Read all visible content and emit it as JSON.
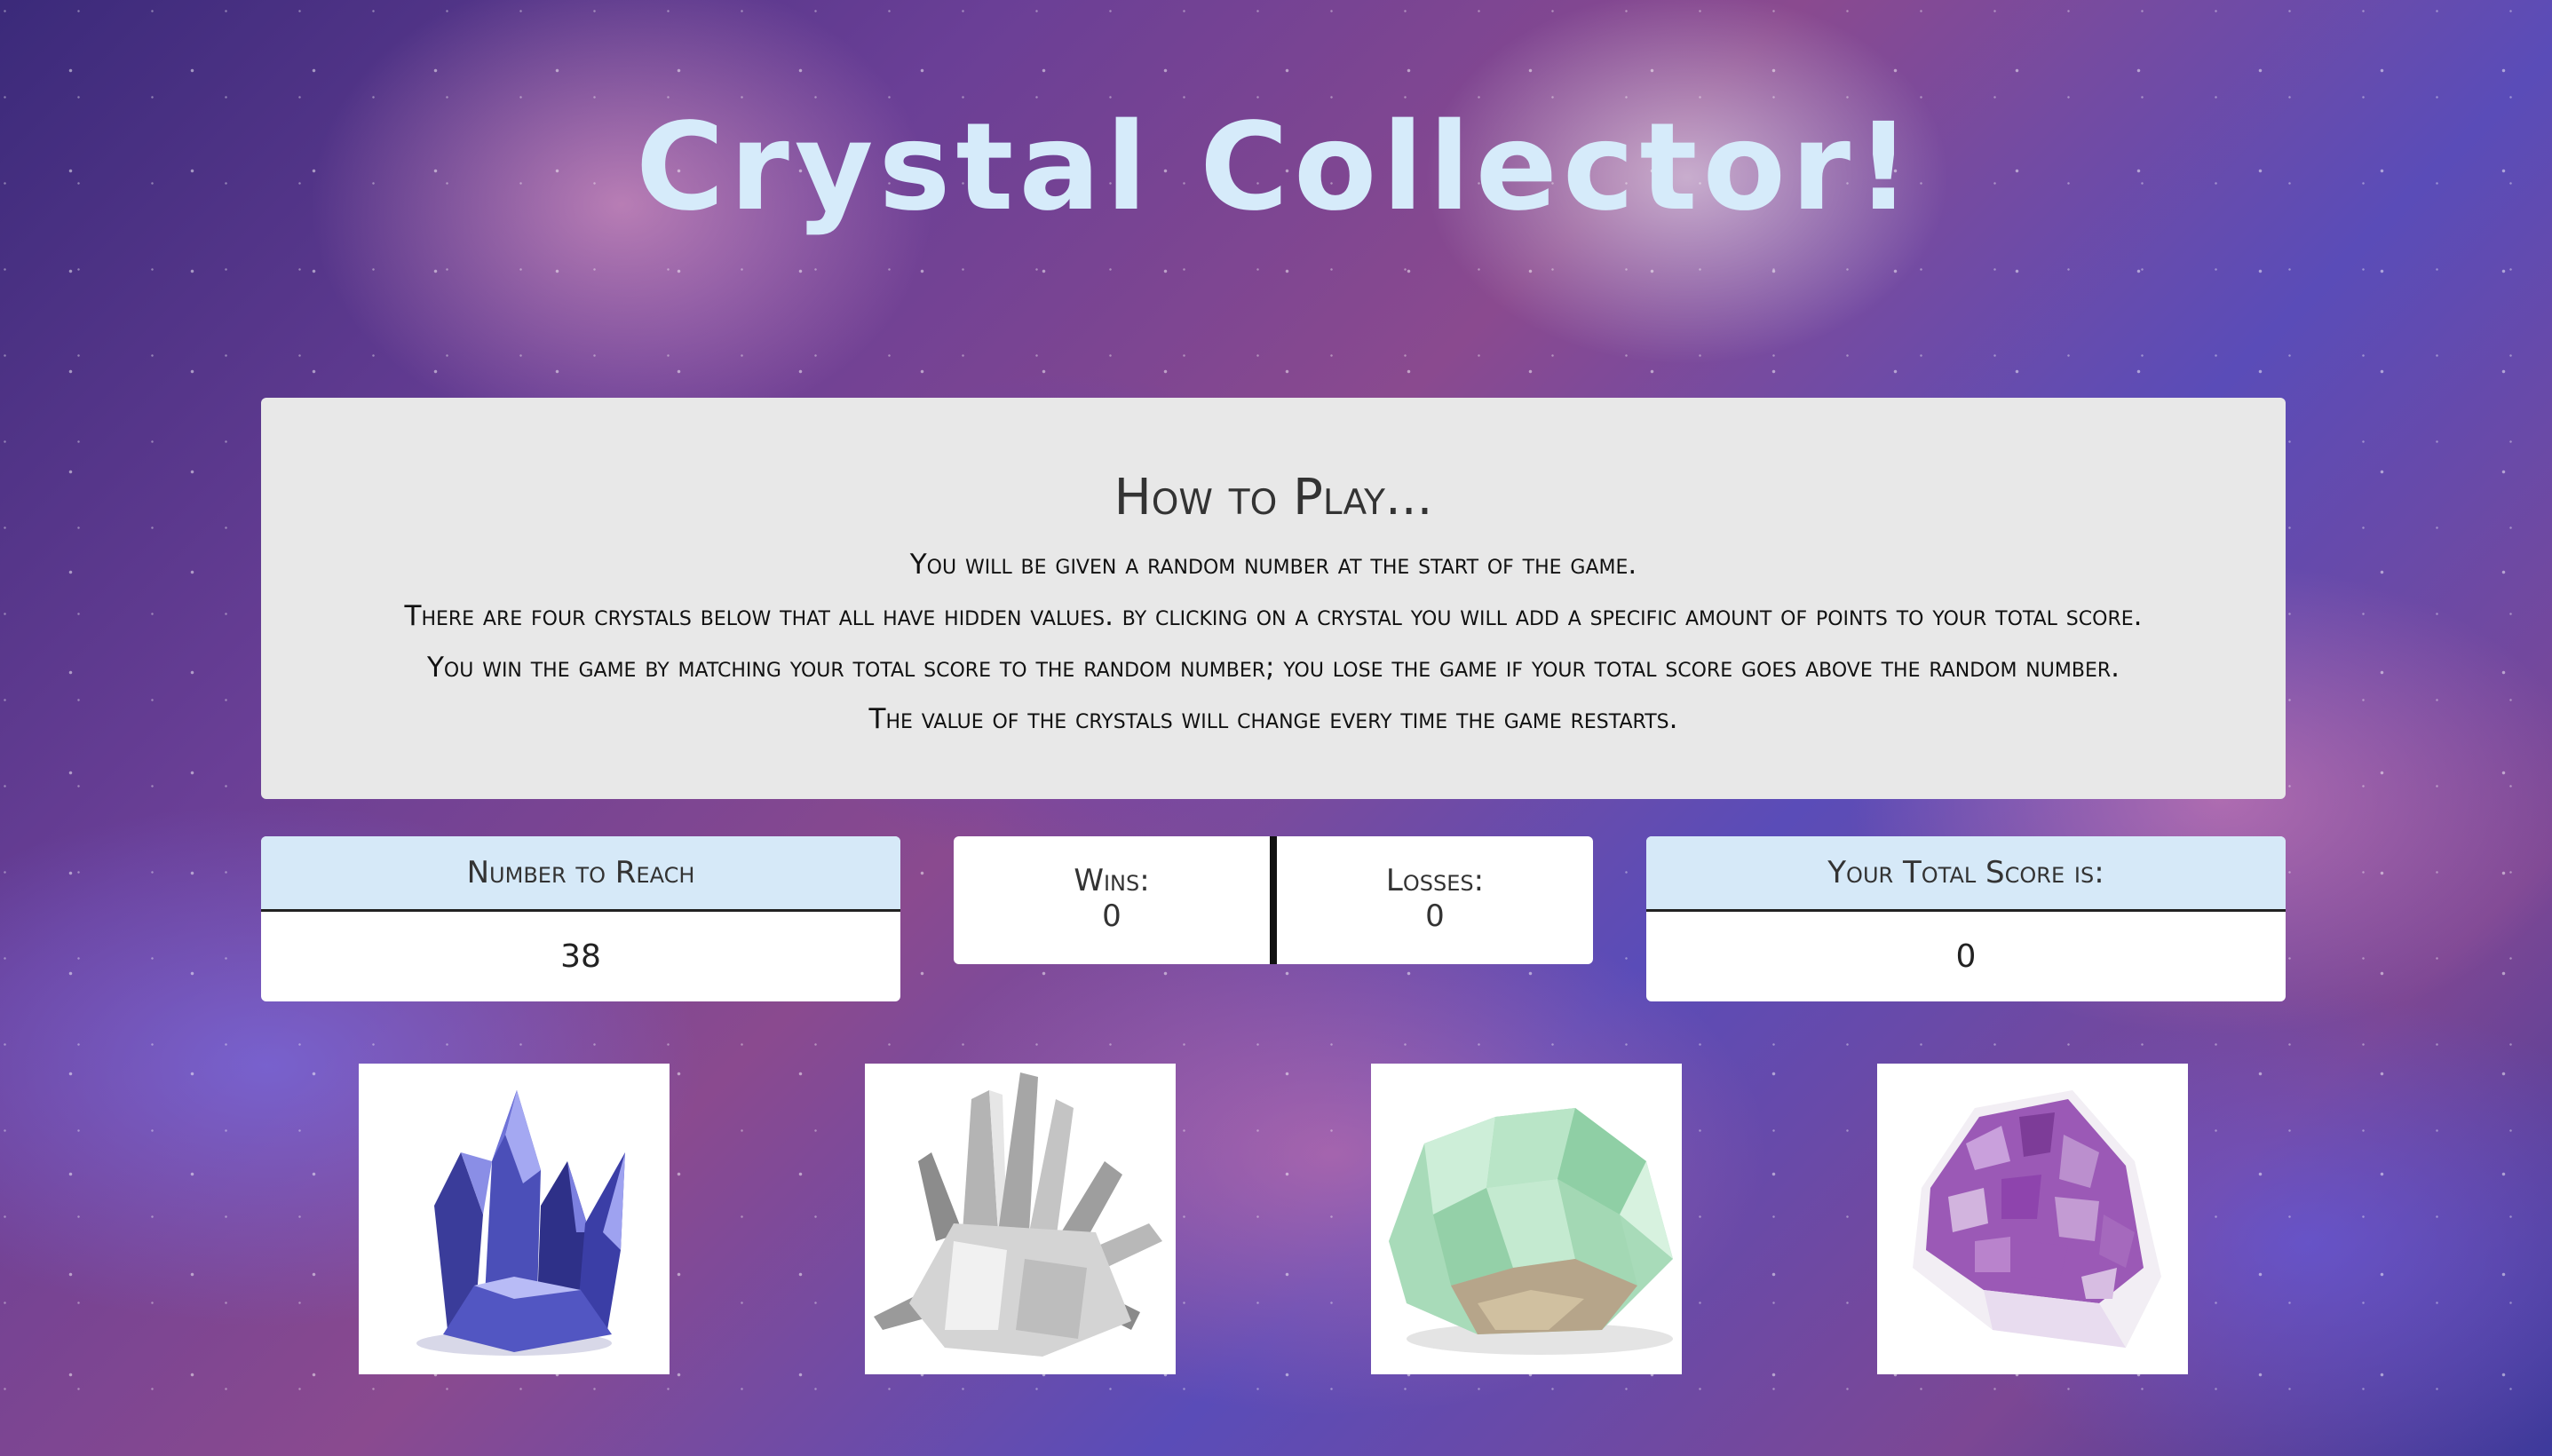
{
  "title": "Crystal Collector!",
  "how_to_play": {
    "heading": "How to Play...",
    "lines": [
      "You will be given a random number at the start of the game.",
      "There are four crystals below that all have hidden values. by clicking on a crystal you will add a specific amount of points to your total score.",
      "You win the game by matching your total score to the random number; you lose the game if your total score goes above the random number.",
      "The value of the crystals will change every time the game restarts."
    ]
  },
  "number_to_reach": {
    "label": "Number to Reach",
    "value": "38"
  },
  "record": {
    "wins_label": "Wins:",
    "wins_value": "0",
    "losses_label": "Losses:",
    "losses_value": "0"
  },
  "total_score": {
    "label": "Your Total Score is:",
    "value": "0"
  },
  "crystals": [
    {
      "icon": "blue-crystal-icon",
      "color": "#4b4fb0"
    },
    {
      "icon": "clear-quartz-crystal-icon",
      "color": "#b9b9b9"
    },
    {
      "icon": "green-fluorite-crystal-icon",
      "color": "#9fd8b4"
    },
    {
      "icon": "amethyst-cluster-crystal-icon",
      "color": "#9b59b6"
    }
  ]
}
